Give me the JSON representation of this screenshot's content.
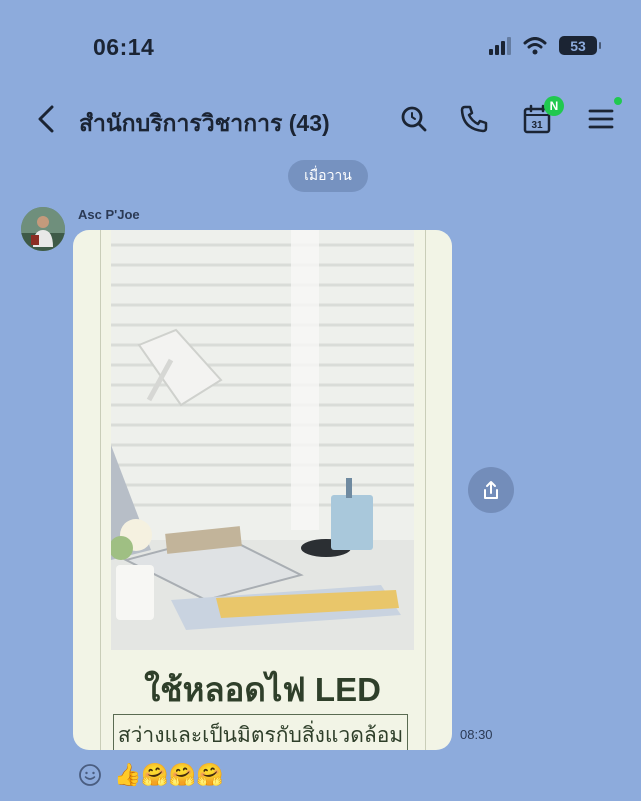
{
  "status_bar": {
    "time": "06:14",
    "battery": "53"
  },
  "header": {
    "title": "สำนักบริการวิชาการ (43)",
    "calendar_day": "31",
    "calendar_badge": "N"
  },
  "chat": {
    "date_separator": "เมื่อวาน",
    "message": {
      "sender": "Asc P'Joe",
      "poster_title": "ใช้หลอดไฟ LED",
      "poster_subtitle": "สว่างและเป็นมิตรกับสิ่งแวดล้อม",
      "time": "08:30"
    },
    "reactions": {
      "emoji": "👍🤗🤗🤗"
    }
  },
  "colors": {
    "background": "#8dabdc",
    "badge_green": "#20c94f",
    "text_dark": "#1b2433"
  },
  "icons": [
    "back-icon",
    "search-icon",
    "phone-icon",
    "calendar-icon",
    "menu-icon",
    "share-icon",
    "emoji-add-icon"
  ]
}
